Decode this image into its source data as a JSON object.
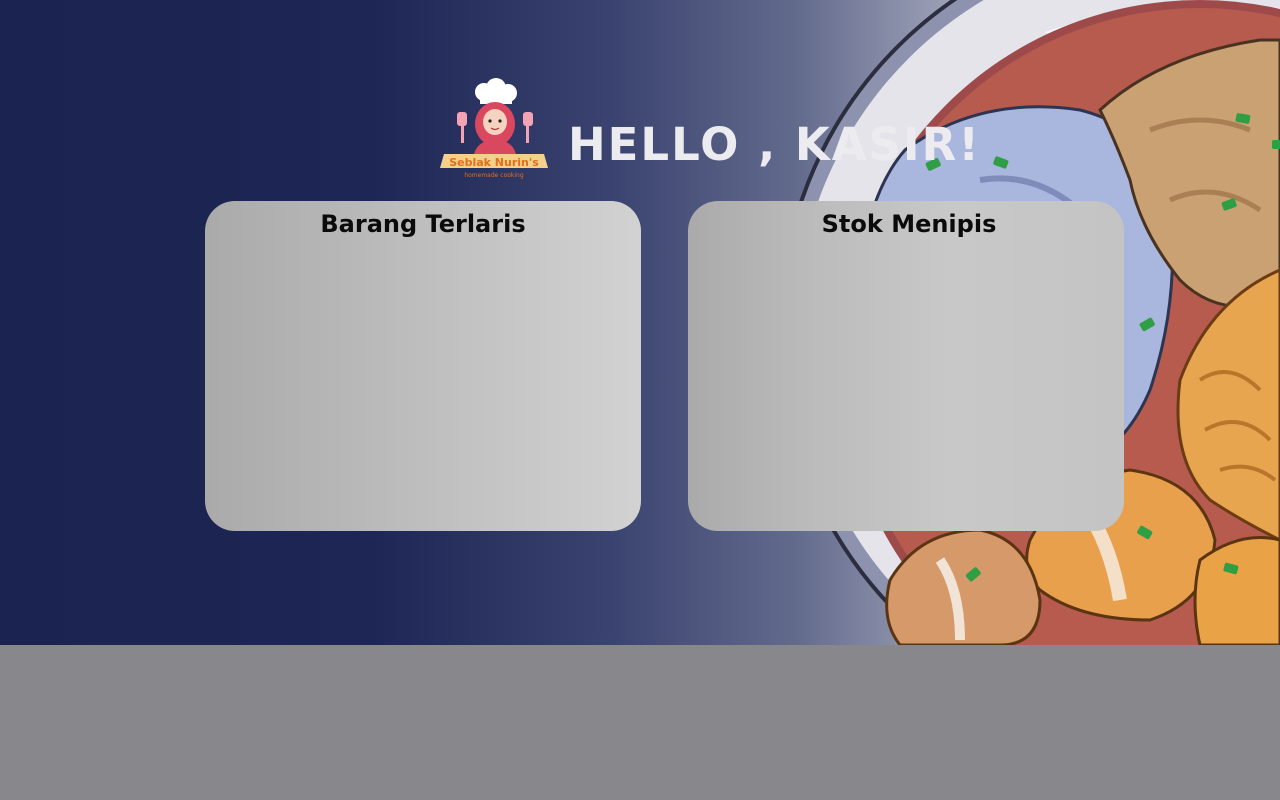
{
  "brand": {
    "logo_text": "Seblak Nurin's",
    "logo_tagline": "homemade cooking"
  },
  "header": {
    "title": "HELLO , KASIR!"
  },
  "panels": {
    "best_sellers": {
      "title": "Barang Terlaris"
    },
    "low_stock": {
      "title": "Stok Menipis"
    }
  },
  "colors": {
    "navy": "#1b2350",
    "footer_gray": "#88878c",
    "card_gray": "#bcbcbc"
  }
}
